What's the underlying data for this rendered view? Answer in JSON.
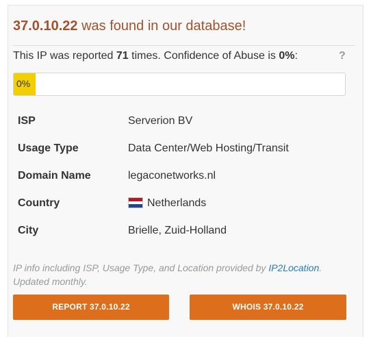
{
  "header": {
    "ip": "37.0.10.22",
    "found_text": "was found in our database!"
  },
  "summary": {
    "prefix": "This IP was reported",
    "count": "71",
    "middle": "times. Confidence of Abuse is",
    "confidence": "0%",
    "suffix": ":",
    "help_label": "?"
  },
  "abuse_meter": {
    "label": "0%",
    "value_percent": 0,
    "color": "#f2cf00"
  },
  "details": [
    {
      "label": "ISP",
      "value": "Serverion BV"
    },
    {
      "label": "Usage Type",
      "value": "Data Center/Web Hosting/Transit"
    },
    {
      "label": "Domain Name",
      "value": "legaconetworks.nl"
    },
    {
      "label": "Country",
      "value": "Netherlands",
      "icon": "netherlands-flag-icon"
    },
    {
      "label": "City",
      "value": "Brielle, Zuid-Holland"
    }
  ],
  "footnote": {
    "before_link": "IP info including ISP, Usage Type, and Location provided by",
    "link_text": "IP2Location",
    "after_link": ". Updated monthly."
  },
  "actions": {
    "report_label": "REPORT 37.0.10.22",
    "whois_label": "WHOIS 37.0.10.22"
  },
  "colors": {
    "accent": "#dd6e1c",
    "title": "#a0522d",
    "link": "#2a7ab8"
  }
}
